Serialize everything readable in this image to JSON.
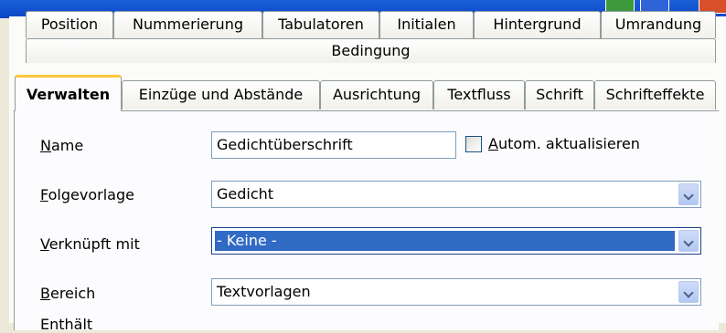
{
  "tabs_row1": [
    "Position",
    "Nummerierung",
    "Tabulatoren",
    "Initialen",
    "Hintergrund",
    "Umrandung"
  ],
  "tabs_row2": [
    "Bedingung"
  ],
  "tabs_row3": [
    "Verwalten",
    "Einzüge und Abstände",
    "Ausrichtung",
    "Textfluss",
    "Schrift",
    "Schrifteffekte"
  ],
  "active_tab": "Verwalten",
  "form": {
    "name": {
      "label_first": "N",
      "label_rest": "ame",
      "value": "Gedichtüberschrift"
    },
    "auto_update": {
      "label_first": "A",
      "label_rest": "utom. aktualisieren",
      "checked": false
    },
    "next_style": {
      "label_first": "F",
      "label_rest": "olgevorlage",
      "value": "Gedicht"
    },
    "linked_with": {
      "label_first": "V",
      "label_rest": "erknüpft mit",
      "value": "- Keine -"
    },
    "category": {
      "label_first": "B",
      "label_rest": "ereich",
      "value": "Textvorlagen"
    },
    "cut_label": "Enthält"
  },
  "colors": {
    "selection": "#316ac5",
    "active_tab_accent": "#ffc83c"
  }
}
